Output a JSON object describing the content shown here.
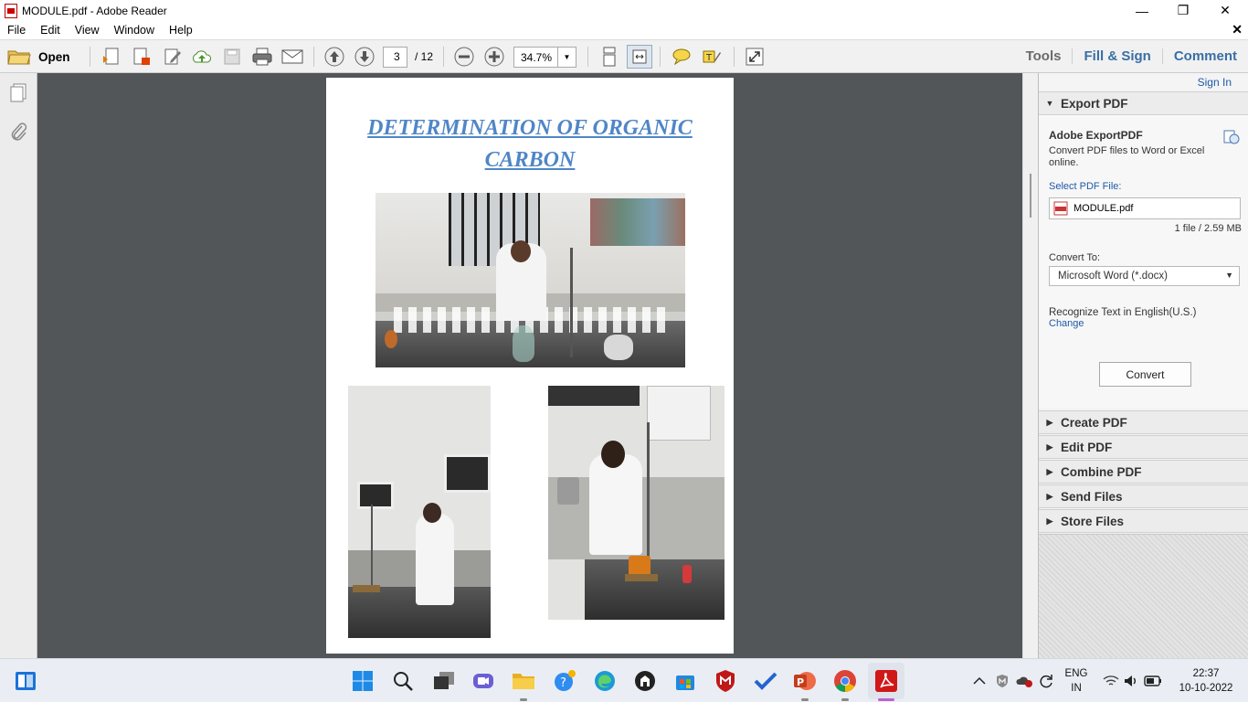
{
  "window": {
    "title": "MODULE.pdf - Adobe Reader",
    "minimize": "—",
    "maximize": "❐",
    "close": "✕"
  },
  "menu": {
    "items": [
      "File",
      "Edit",
      "View",
      "Window",
      "Help"
    ],
    "close_doc": "✕"
  },
  "toolbar": {
    "open_label": "Open",
    "page_current": "3",
    "page_total": "/ 12",
    "zoom": "34.7%"
  },
  "right_tabs": {
    "tools": "Tools",
    "fill_sign": "Fill & Sign",
    "comment": "Comment"
  },
  "document": {
    "title": "DETERMINATION OF ORGANIC CARBON"
  },
  "panel": {
    "sign_in": "Sign In",
    "export": {
      "header": "Export PDF",
      "service_title": "Adobe ExportPDF",
      "description": "Convert PDF files to Word or Excel online.",
      "select_label": "Select PDF File:",
      "file_name": "MODULE.pdf",
      "file_info": "1 file / 2.59 MB",
      "convert_to_label": "Convert To:",
      "convert_to_value": "Microsoft Word (*.docx)",
      "recognize_text": "Recognize Text in English(U.S.)",
      "change_link": "Change",
      "convert_button": "Convert"
    },
    "sections": [
      "Create PDF",
      "Edit PDF",
      "Combine PDF",
      "Send Files",
      "Store Files"
    ]
  },
  "taskbar": {
    "lang_top": "ENG",
    "lang_bottom": "IN",
    "time": "22:37",
    "date": "10-10-2022"
  },
  "colors": {
    "accent": "#3a6ea5",
    "doc_title": "#4f86c6",
    "doc_bg": "#525659"
  }
}
